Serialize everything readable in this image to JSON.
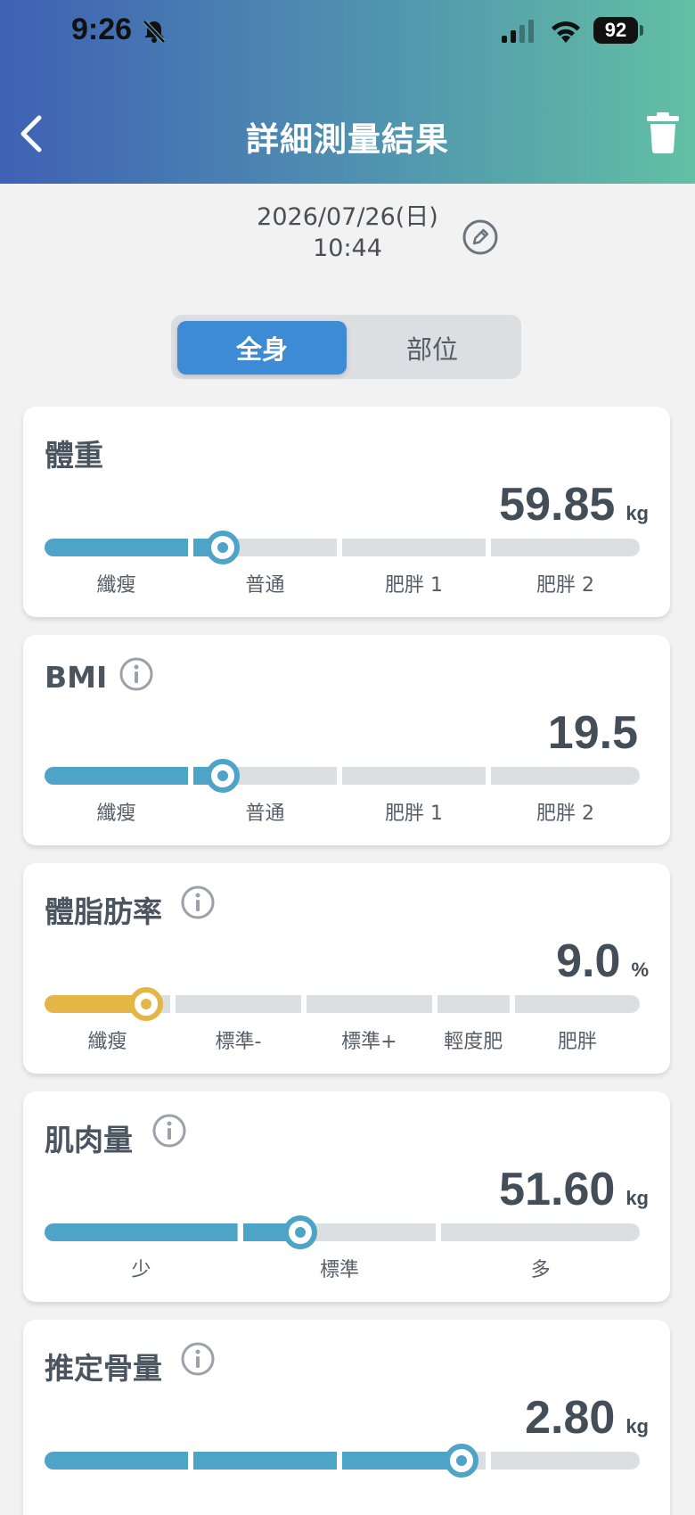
{
  "status": {
    "time": "9:26",
    "battery": "92"
  },
  "header": {
    "title": "詳細測量結果"
  },
  "datetime": {
    "date": "2026/07/26(日)",
    "time": "10:44"
  },
  "tabs": [
    {
      "label": "全身",
      "active": true
    },
    {
      "label": "部位",
      "active": false
    }
  ],
  "colors": {
    "blue": "#4ea4c6",
    "yellow": "#e3b645",
    "track": "#dcdfe2",
    "accent": "#3d8bd4"
  },
  "metrics": [
    {
      "title": "體重",
      "info": false,
      "value": "59.85",
      "unit": "kg",
      "categories": [
        "纖瘦",
        "普通",
        "肥胖 1",
        "肥胖 2"
      ],
      "active_index": 1,
      "level": 0.3
    },
    {
      "title": "BMI",
      "info": true,
      "value": "19.5",
      "unit": "",
      "categories": [
        "纖瘦",
        "普通",
        "肥胖 1",
        "肥胖 2"
      ],
      "active_index": 1,
      "level": 0.3
    },
    {
      "title": "體脂肪率",
      "info": true,
      "value": "9.0",
      "unit": "%",
      "categories": [
        "纖瘦",
        "標準-",
        "標準+",
        "輕度肥",
        "肥胖"
      ],
      "active_index": 0,
      "level": 0.17
    },
    {
      "title": "肌肉量",
      "info": true,
      "value": "51.60",
      "unit": "kg",
      "categories": [
        "少",
        "標準",
        "多"
      ],
      "active_index": 1,
      "level": 0.43
    },
    {
      "title": "推定骨量",
      "info": true,
      "value": "2.80",
      "unit": "kg",
      "categories": [],
      "active_index": 2,
      "level": 0.7
    }
  ]
}
